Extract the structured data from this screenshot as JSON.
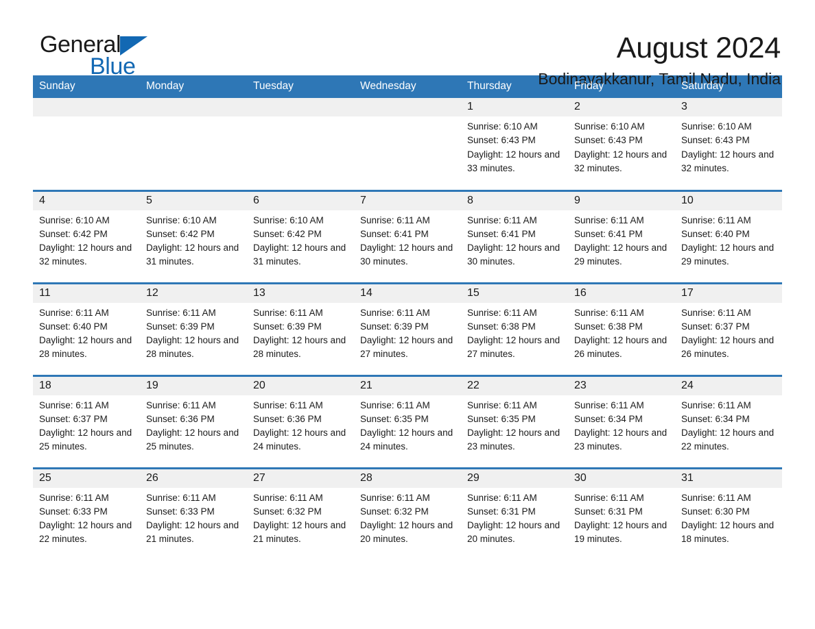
{
  "logo": {
    "text_primary": "General",
    "text_secondary": "Blue",
    "triangle_icon": "triangle-icon",
    "accent_color": "#1268b3"
  },
  "header": {
    "month_title": "August 2024",
    "location": "Bodinayakkanur, Tamil Nadu, India"
  },
  "calendar": {
    "header_color": "#2e77b6",
    "daynum_bg": "#f0f0f0",
    "weekday_headers": [
      "Sunday",
      "Monday",
      "Tuesday",
      "Wednesday",
      "Thursday",
      "Friday",
      "Saturday"
    ],
    "weeks": [
      [
        {
          "day": "",
          "empty": true
        },
        {
          "day": "",
          "empty": true
        },
        {
          "day": "",
          "empty": true
        },
        {
          "day": "",
          "empty": true
        },
        {
          "day": "1",
          "sunrise": "Sunrise: 6:10 AM",
          "sunset": "Sunset: 6:43 PM",
          "daylight": "Daylight: 12 hours and 33 minutes."
        },
        {
          "day": "2",
          "sunrise": "Sunrise: 6:10 AM",
          "sunset": "Sunset: 6:43 PM",
          "daylight": "Daylight: 12 hours and 32 minutes."
        },
        {
          "day": "3",
          "sunrise": "Sunrise: 6:10 AM",
          "sunset": "Sunset: 6:43 PM",
          "daylight": "Daylight: 12 hours and 32 minutes."
        }
      ],
      [
        {
          "day": "4",
          "sunrise": "Sunrise: 6:10 AM",
          "sunset": "Sunset: 6:42 PM",
          "daylight": "Daylight: 12 hours and 32 minutes."
        },
        {
          "day": "5",
          "sunrise": "Sunrise: 6:10 AM",
          "sunset": "Sunset: 6:42 PM",
          "daylight": "Daylight: 12 hours and 31 minutes."
        },
        {
          "day": "6",
          "sunrise": "Sunrise: 6:10 AM",
          "sunset": "Sunset: 6:42 PM",
          "daylight": "Daylight: 12 hours and 31 minutes."
        },
        {
          "day": "7",
          "sunrise": "Sunrise: 6:11 AM",
          "sunset": "Sunset: 6:41 PM",
          "daylight": "Daylight: 12 hours and 30 minutes."
        },
        {
          "day": "8",
          "sunrise": "Sunrise: 6:11 AM",
          "sunset": "Sunset: 6:41 PM",
          "daylight": "Daylight: 12 hours and 30 minutes."
        },
        {
          "day": "9",
          "sunrise": "Sunrise: 6:11 AM",
          "sunset": "Sunset: 6:41 PM",
          "daylight": "Daylight: 12 hours and 29 minutes."
        },
        {
          "day": "10",
          "sunrise": "Sunrise: 6:11 AM",
          "sunset": "Sunset: 6:40 PM",
          "daylight": "Daylight: 12 hours and 29 minutes."
        }
      ],
      [
        {
          "day": "11",
          "sunrise": "Sunrise: 6:11 AM",
          "sunset": "Sunset: 6:40 PM",
          "daylight": "Daylight: 12 hours and 28 minutes."
        },
        {
          "day": "12",
          "sunrise": "Sunrise: 6:11 AM",
          "sunset": "Sunset: 6:39 PM",
          "daylight": "Daylight: 12 hours and 28 minutes."
        },
        {
          "day": "13",
          "sunrise": "Sunrise: 6:11 AM",
          "sunset": "Sunset: 6:39 PM",
          "daylight": "Daylight: 12 hours and 28 minutes."
        },
        {
          "day": "14",
          "sunrise": "Sunrise: 6:11 AM",
          "sunset": "Sunset: 6:39 PM",
          "daylight": "Daylight: 12 hours and 27 minutes."
        },
        {
          "day": "15",
          "sunrise": "Sunrise: 6:11 AM",
          "sunset": "Sunset: 6:38 PM",
          "daylight": "Daylight: 12 hours and 27 minutes."
        },
        {
          "day": "16",
          "sunrise": "Sunrise: 6:11 AM",
          "sunset": "Sunset: 6:38 PM",
          "daylight": "Daylight: 12 hours and 26 minutes."
        },
        {
          "day": "17",
          "sunrise": "Sunrise: 6:11 AM",
          "sunset": "Sunset: 6:37 PM",
          "daylight": "Daylight: 12 hours and 26 minutes."
        }
      ],
      [
        {
          "day": "18",
          "sunrise": "Sunrise: 6:11 AM",
          "sunset": "Sunset: 6:37 PM",
          "daylight": "Daylight: 12 hours and 25 minutes."
        },
        {
          "day": "19",
          "sunrise": "Sunrise: 6:11 AM",
          "sunset": "Sunset: 6:36 PM",
          "daylight": "Daylight: 12 hours and 25 minutes."
        },
        {
          "day": "20",
          "sunrise": "Sunrise: 6:11 AM",
          "sunset": "Sunset: 6:36 PM",
          "daylight": "Daylight: 12 hours and 24 minutes."
        },
        {
          "day": "21",
          "sunrise": "Sunrise: 6:11 AM",
          "sunset": "Sunset: 6:35 PM",
          "daylight": "Daylight: 12 hours and 24 minutes."
        },
        {
          "day": "22",
          "sunrise": "Sunrise: 6:11 AM",
          "sunset": "Sunset: 6:35 PM",
          "daylight": "Daylight: 12 hours and 23 minutes."
        },
        {
          "day": "23",
          "sunrise": "Sunrise: 6:11 AM",
          "sunset": "Sunset: 6:34 PM",
          "daylight": "Daylight: 12 hours and 23 minutes."
        },
        {
          "day": "24",
          "sunrise": "Sunrise: 6:11 AM",
          "sunset": "Sunset: 6:34 PM",
          "daylight": "Daylight: 12 hours and 22 minutes."
        }
      ],
      [
        {
          "day": "25",
          "sunrise": "Sunrise: 6:11 AM",
          "sunset": "Sunset: 6:33 PM",
          "daylight": "Daylight: 12 hours and 22 minutes."
        },
        {
          "day": "26",
          "sunrise": "Sunrise: 6:11 AM",
          "sunset": "Sunset: 6:33 PM",
          "daylight": "Daylight: 12 hours and 21 minutes."
        },
        {
          "day": "27",
          "sunrise": "Sunrise: 6:11 AM",
          "sunset": "Sunset: 6:32 PM",
          "daylight": "Daylight: 12 hours and 21 minutes."
        },
        {
          "day": "28",
          "sunrise": "Sunrise: 6:11 AM",
          "sunset": "Sunset: 6:32 PM",
          "daylight": "Daylight: 12 hours and 20 minutes."
        },
        {
          "day": "29",
          "sunrise": "Sunrise: 6:11 AM",
          "sunset": "Sunset: 6:31 PM",
          "daylight": "Daylight: 12 hours and 20 minutes."
        },
        {
          "day": "30",
          "sunrise": "Sunrise: 6:11 AM",
          "sunset": "Sunset: 6:31 PM",
          "daylight": "Daylight: 12 hours and 19 minutes."
        },
        {
          "day": "31",
          "sunrise": "Sunrise: 6:11 AM",
          "sunset": "Sunset: 6:30 PM",
          "daylight": "Daylight: 12 hours and 18 minutes."
        }
      ]
    ]
  }
}
